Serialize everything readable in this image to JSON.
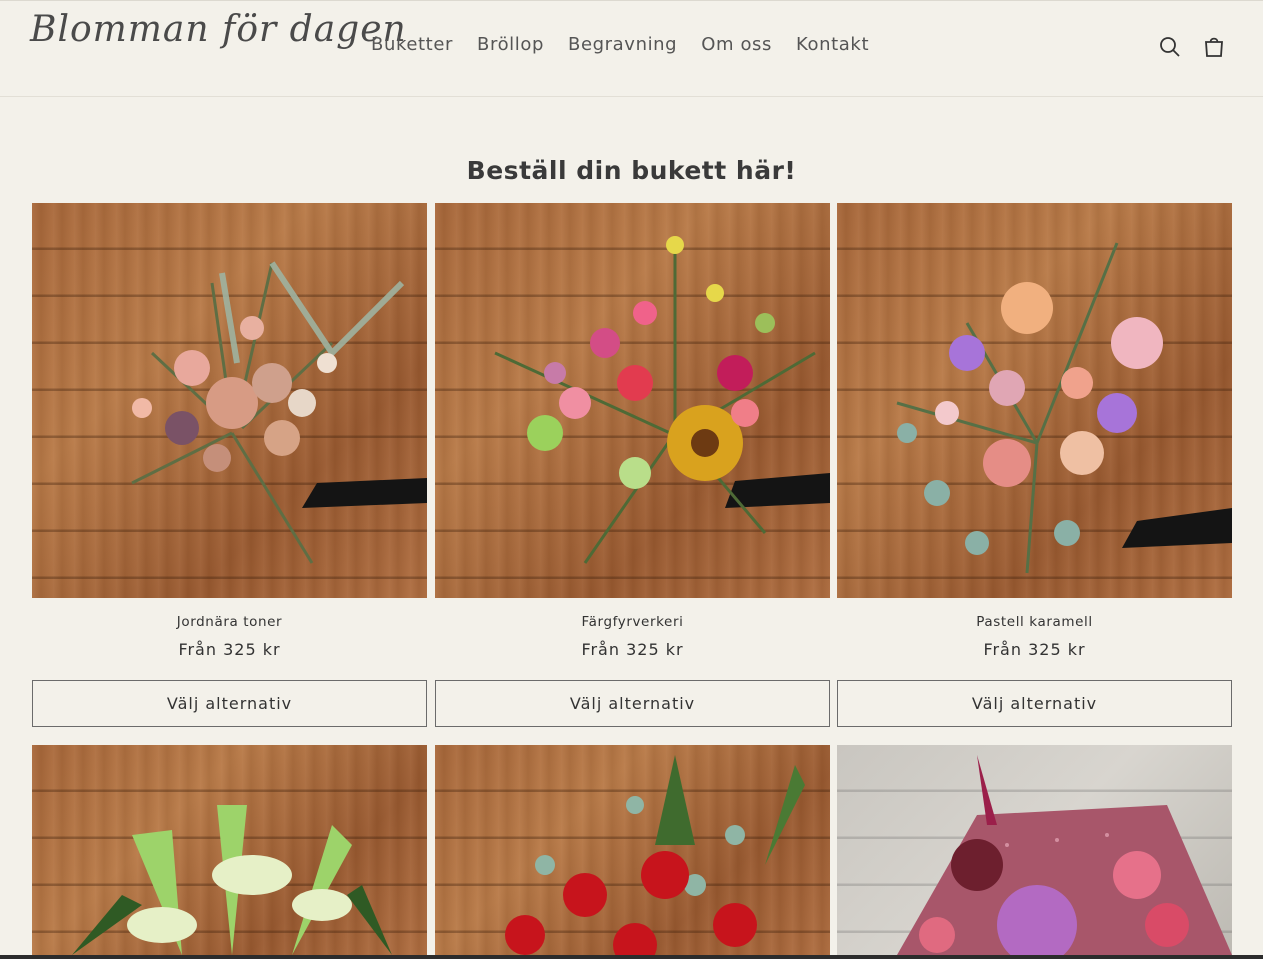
{
  "header": {
    "logo": "Blomman för dagen",
    "nav": [
      "Buketter",
      "Bröllop",
      "Begravning",
      "Om oss",
      "Kontakt"
    ],
    "search_icon": "search-icon",
    "cart_icon": "cart-icon"
  },
  "main": {
    "heading": "Beställ din bukett här!",
    "products": [
      {
        "title": "Jordnära toner",
        "price": "Från 325 kr",
        "button": "Välj alternativ"
      },
      {
        "title": "Färgfyrverkeri",
        "price": "Från 325 kr",
        "button": "Välj alternativ"
      },
      {
        "title": "Pastell karamell",
        "price": "Från 325 kr",
        "button": "Välj alternativ"
      }
    ]
  },
  "colors": {
    "background": "#f3f1ea",
    "text": "#333333",
    "border": "#6b6b6b"
  }
}
